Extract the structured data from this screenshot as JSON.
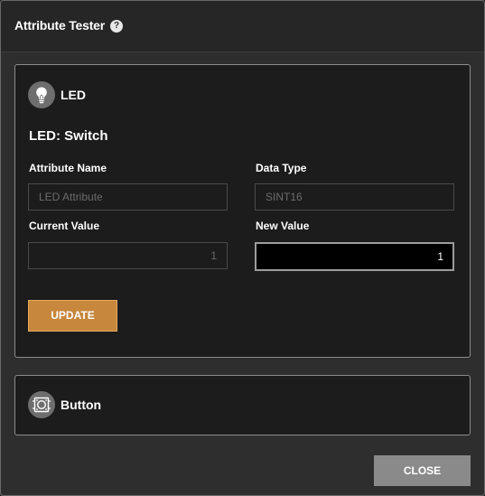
{
  "dialog": {
    "title": "Attribute Tester",
    "help_glyph": "?"
  },
  "led_panel": {
    "device_name": "LED",
    "device_icon": "lightbulb-icon",
    "section_title": "LED: Switch",
    "attribute_name_label": "Attribute Name",
    "attribute_name_value": "LED Attribute",
    "data_type_label": "Data Type",
    "data_type_value": "SINT16",
    "current_value_label": "Current Value",
    "current_value": "1",
    "new_value_label": "New Value",
    "new_value": "1",
    "update_label": "UPDATE"
  },
  "button_panel": {
    "device_name": "Button",
    "device_icon": "button-chip-icon"
  },
  "footer": {
    "close_label": "CLOSE"
  },
  "colors": {
    "accent": "#c7873c",
    "panel_bg": "#1c1c1c",
    "dialog_bg": "#2e2e2e"
  }
}
